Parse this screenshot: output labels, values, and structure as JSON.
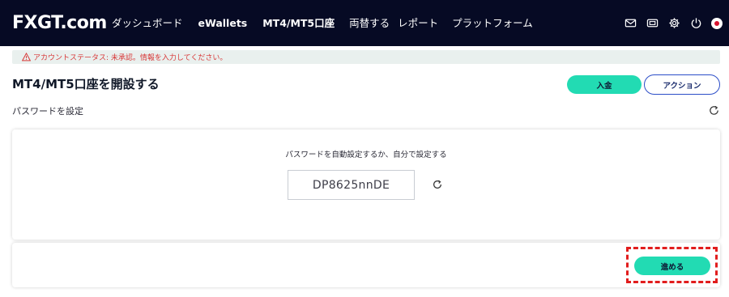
{
  "brand": {
    "logo_text": "FXGT.com"
  },
  "nav": {
    "items": [
      {
        "label": "ダッシュボード"
      },
      {
        "label": "eWallets"
      },
      {
        "label": "MT4/MT5口座"
      },
      {
        "label": "両替する"
      },
      {
        "label": "レポート"
      },
      {
        "label": "プラットフォーム"
      }
    ]
  },
  "header_icons": [
    "mail-icon",
    "ticket-icon",
    "gear-icon",
    "power-icon",
    "flag-japan-icon"
  ],
  "alert": {
    "text": "アカウントステータス: 未承認。情報を入力してください。",
    "icon": "warning-icon",
    "color": "#d83939"
  },
  "page": {
    "title": "MT4/MT5口座を開設する",
    "deposit_label": "入金",
    "action_label": "アクション",
    "section_label": "パスワードを設定"
  },
  "password": {
    "caption": "パスワードを自動設定するか、自分で設定する",
    "value": "DP8625nnDE"
  },
  "footer": {
    "next_label": "進める"
  },
  "colors": {
    "header_bg": "#060a24",
    "accent": "#22dbb3",
    "action_border": "#2c4ec8",
    "highlight": "#e11d1d"
  }
}
